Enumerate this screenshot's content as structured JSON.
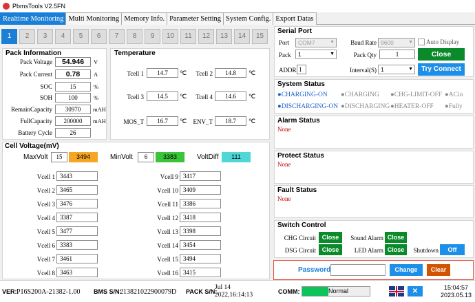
{
  "window": {
    "title": "PbmsTools V2.5FN"
  },
  "tabs": [
    "Realtime Monitoring",
    "Multi Monitoring",
    "Memory Info.",
    "Parameter Setting",
    "System Config.",
    "Export Datas"
  ],
  "cells": [
    "1",
    "2",
    "3",
    "4",
    "5",
    "6",
    "7",
    "8",
    "9",
    "10",
    "11",
    "12",
    "13",
    "14",
    "15"
  ],
  "pack": {
    "title": "Pack Information",
    "voltage_label": "Pack Voltage",
    "voltage": "54.946",
    "voltage_unit": "V",
    "current_label": "Pack Current",
    "current": "0.78",
    "current_unit": "A",
    "soc_label": "SOC",
    "soc": "15",
    "soc_unit": "%",
    "soh_label": "SOH",
    "soh": "100",
    "soh_unit": "%",
    "remain_label": "RemainCapacity",
    "remain": "30970",
    "remain_unit": "mAH",
    "full_label": "FullCapacity",
    "full": "200000",
    "full_unit": "mAH",
    "cycle_label": "Battery Cycle",
    "cycle": "26"
  },
  "temperature": {
    "title": "Temperature",
    "unit": "℃",
    "tcell1_label": "Tcell 1",
    "tcell1": "14.7",
    "tcell2_label": "Tcell 2",
    "tcell2": "14.8",
    "tcell3_label": "Tcell 3",
    "tcell3": "14.5",
    "tcell4_label": "Tcell 4",
    "tcell4": "14.6",
    "mos_label": "MOS_T",
    "mos": "16.7",
    "env_label": "ENV_T",
    "env": "18.7"
  },
  "cellvoltage": {
    "title": "Cell Voltage(mV)",
    "maxvolt_label": "MaxVolt",
    "maxvolt_index": "15",
    "maxvolt": "3494",
    "minvolt_label": "MinVolt",
    "minvolt_index": "6",
    "minvolt": "3383",
    "voltdiff_label": "VoltDiff",
    "voltdiff": "111",
    "left": [
      {
        "label": "Vcell 1",
        "value": "3443"
      },
      {
        "label": "Vcell 2",
        "value": "3465"
      },
      {
        "label": "Vcell 3",
        "value": "3476"
      },
      {
        "label": "Vcell 4",
        "value": "3387"
      },
      {
        "label": "Vcell 5",
        "value": "3477"
      },
      {
        "label": "Vcell 6",
        "value": "3383"
      },
      {
        "label": "Vcell 7",
        "value": "3461"
      },
      {
        "label": "Vcell 8",
        "value": "3463"
      }
    ],
    "right": [
      {
        "label": "Vcell 9",
        "value": "3417"
      },
      {
        "label": "Vcell 10",
        "value": "3409"
      },
      {
        "label": "Vcell 11",
        "value": "3386"
      },
      {
        "label": "Vcell 12",
        "value": "3418"
      },
      {
        "label": "Vcell 13",
        "value": "3398"
      },
      {
        "label": "Vcell 14",
        "value": "3454"
      },
      {
        "label": "Vcell 15",
        "value": "3494"
      },
      {
        "label": "Vcell 16",
        "value": "3415"
      }
    ]
  },
  "serial": {
    "title": "Serial Port",
    "port_label": "Port",
    "port": "COM7",
    "baud_label": "Baud Rate",
    "baud": "9600",
    "auto_label": "Auto Display",
    "pack_label": "Pack",
    "pack": "1",
    "packqty_label": "Pack Qty",
    "packqty": "1",
    "close_label": "Close",
    "addr_label": "ADDR",
    "addr": "1",
    "interval_label": "Interval(S)",
    "interval": "1",
    "tryconnect_label": "Try Connect"
  },
  "system_status": {
    "title": "System Status",
    "charging_on": "CHARGING-ON",
    "charging": "CHARGING",
    "chg_limit_off": "CHG-LIMIT-OFF",
    "acin": "ACin",
    "discharging_on": "DISCHARGING-ON",
    "discharging": "DISCHARGING",
    "heater_off": "HEATER-OFF",
    "fully": "Fully"
  },
  "alarm": {
    "title": "Alarm Status",
    "value": "None"
  },
  "protect": {
    "title": "Protect Status",
    "value": "None"
  },
  "fault": {
    "title": "Fault Status",
    "value": "None"
  },
  "switch": {
    "title": "Switch Control",
    "chg_label": "CHG Circuit",
    "chg_btn": "Close",
    "sound_label": "Sound Alarm",
    "sound_btn": "Close",
    "dsg_label": "DSG Circuit",
    "dsg_btn": "Close",
    "led_label": "LED Alarm",
    "led_btn": "Close",
    "shutdown_label": "Shutdown",
    "shutdown_btn": "Off"
  },
  "password": {
    "label": "Password",
    "value": "",
    "change_label": "Change",
    "clear_label": "Clear"
  },
  "footer": {
    "ver_label": "VER:",
    "ver": "P16S200A-21382-1.00",
    "bms_label": "BMS S/N:",
    "bms": "213821022900079D",
    "pack_label": "PACK S/N:",
    "pack_line1": "Jul 14",
    "pack_line2": "2022,16:14:13",
    "comm_label": "COMM:",
    "comm": "Normal",
    "time": "15:04:57",
    "date": "2023.05.13"
  },
  "colors": {
    "accent": "#1b7fd6",
    "green": "#0a8a2a",
    "orange": "#f5a623",
    "min_green": "#3ac43a",
    "cyan": "#4fd6d6"
  }
}
